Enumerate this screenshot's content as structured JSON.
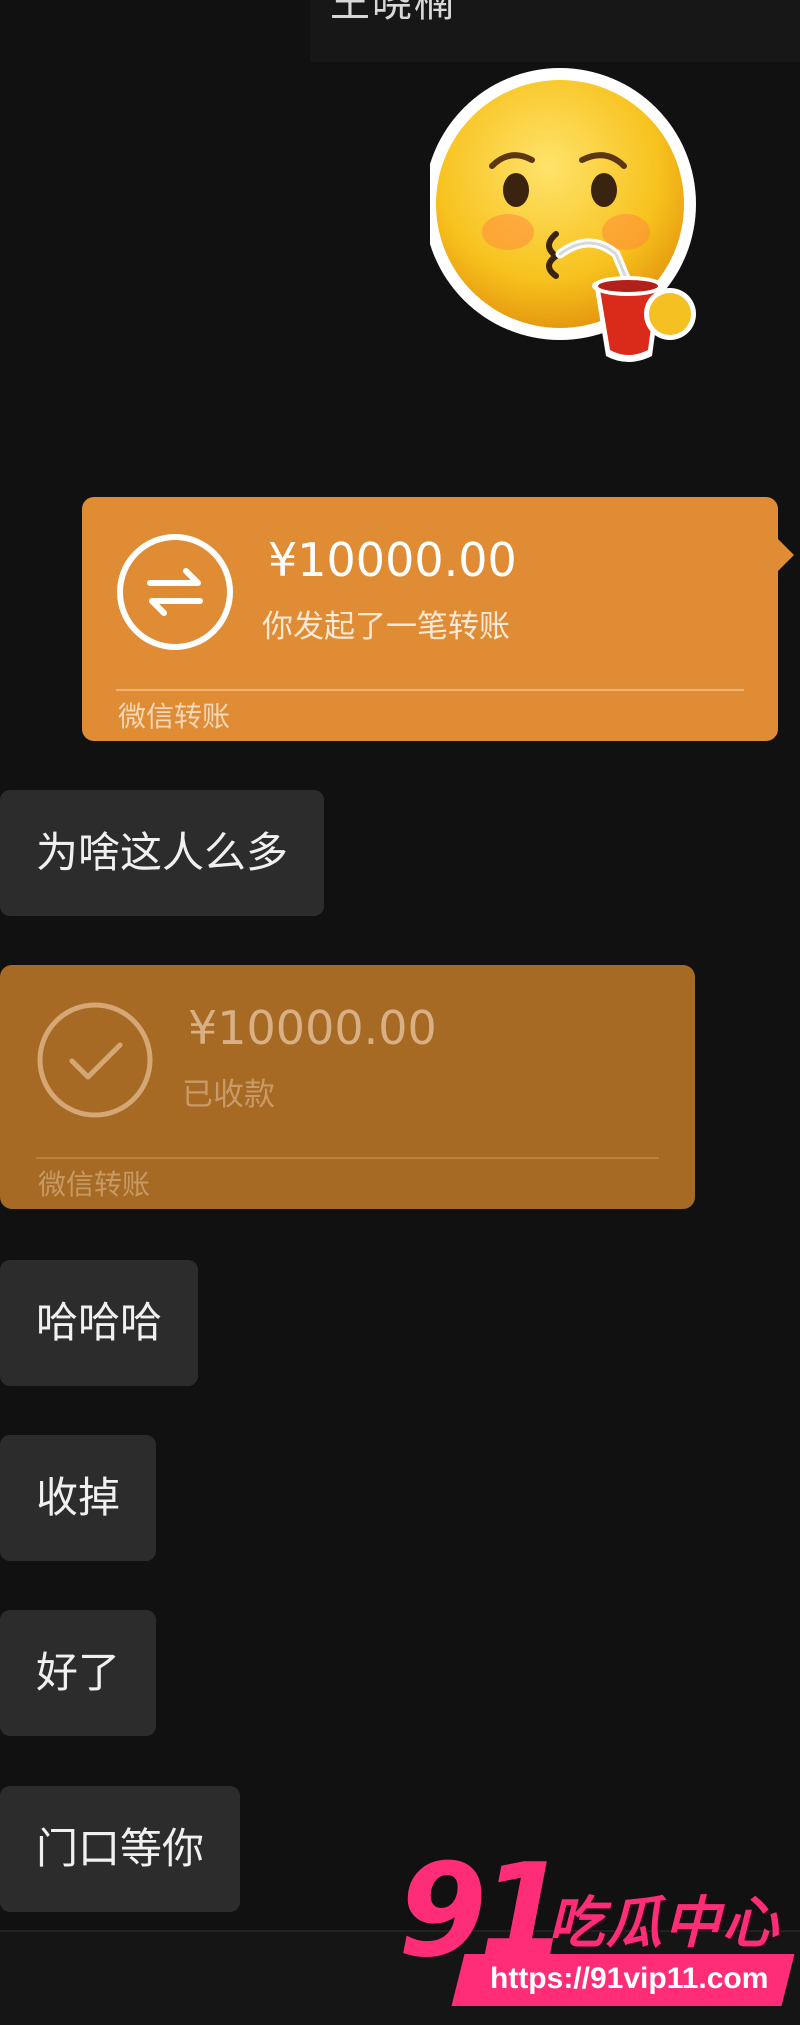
{
  "header": {
    "contact_name": "王晓楠"
  },
  "messages": {
    "sent_transfer": {
      "amount": "¥10000.00",
      "status": "你发起了一笔转账",
      "footer": "微信转账"
    },
    "text_1": "为啥这人么多",
    "received_transfer": {
      "amount": "¥10000.00",
      "status": "已收款",
      "footer": "微信转账"
    },
    "text_2": "哈哈哈",
    "text_3": "收掉",
    "text_4": "好了",
    "text_5": "门口等你"
  },
  "watermark": {
    "number": "91",
    "site_name": "吃瓜中心",
    "url": "https://91vip11.com"
  },
  "colors": {
    "background": "#111111",
    "sent_transfer": "#e08c35",
    "received_transfer": "#a66a25",
    "bubble": "#2c2c2c",
    "watermark_pink": "#ff2d78"
  },
  "icons": {
    "sticker": "sipping-drink-emoji-icon",
    "sent_transfer": "transfer-arrows-icon",
    "received_transfer": "checkmark-circle-icon"
  }
}
